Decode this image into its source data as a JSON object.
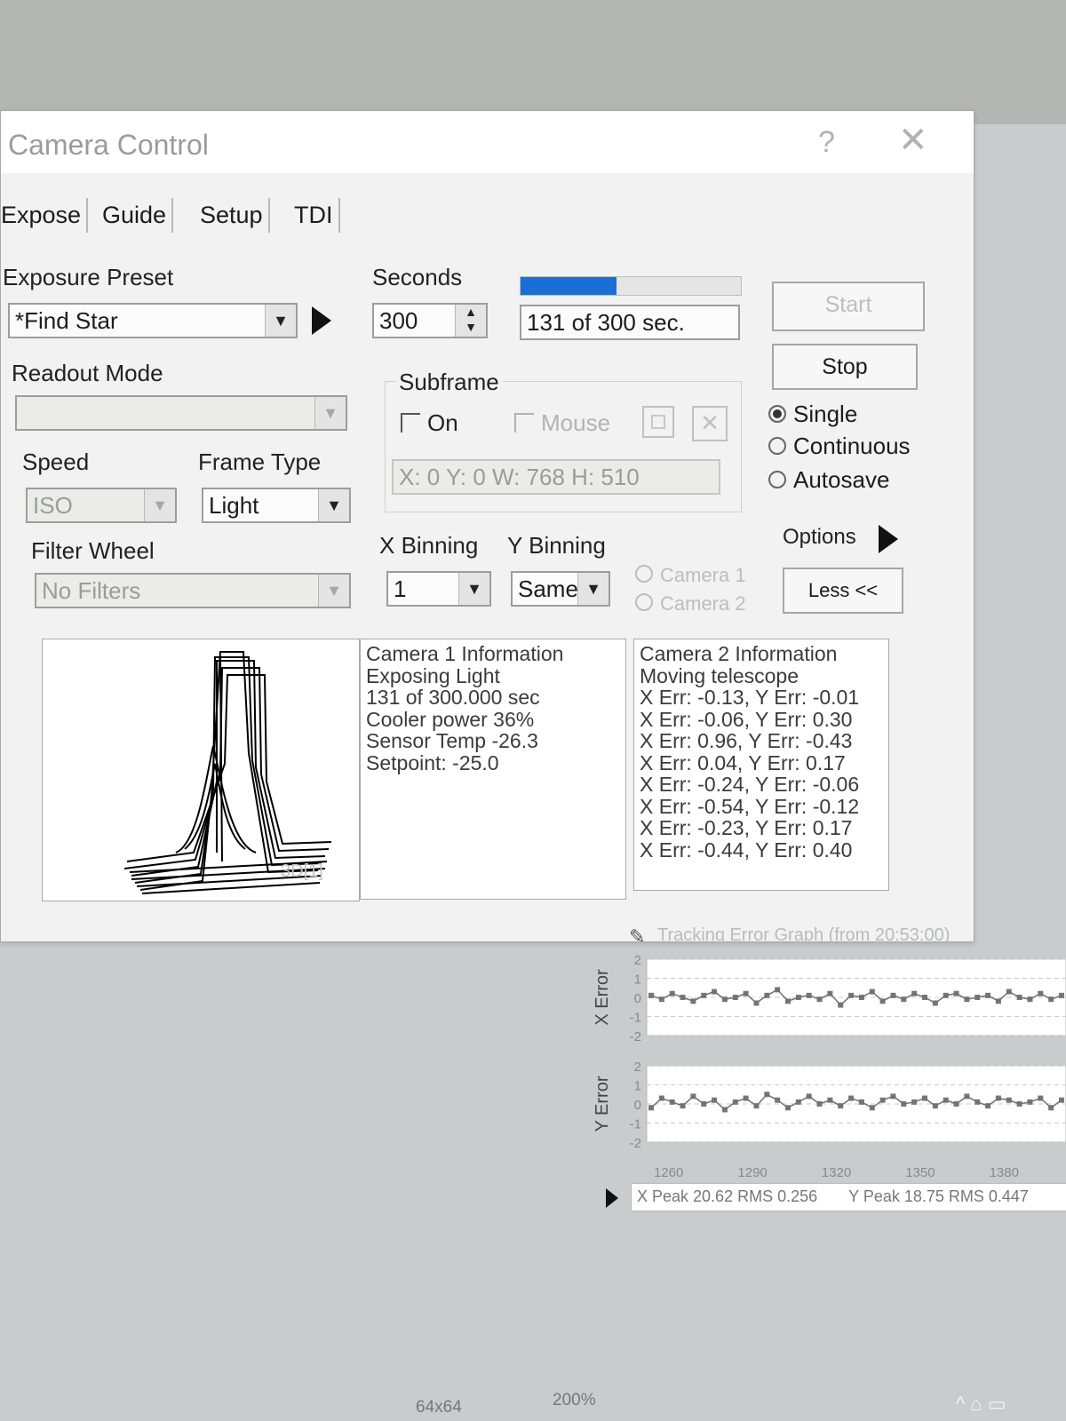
{
  "window": {
    "title": "Camera Control",
    "help": "?",
    "close": "✕"
  },
  "tabs": [
    "Expose",
    "Guide",
    "Setup",
    "TDI"
  ],
  "exposure": {
    "preset_label": "Exposure Preset",
    "preset_value": "*Find Star",
    "seconds_label": "Seconds",
    "seconds_value": "300",
    "progress_fraction": 0.437,
    "progress_text": "131 of 300 sec."
  },
  "buttons": {
    "start": "Start",
    "stop": "Stop",
    "options": "Options",
    "less": "Less <<"
  },
  "mode": {
    "single": "Single",
    "continuous": "Continuous",
    "autosave": "Autosave",
    "selected": "single"
  },
  "readout": {
    "label": "Readout Mode",
    "value": ""
  },
  "subframe": {
    "label": "Subframe",
    "on_label": "On",
    "mouse_label": "Mouse",
    "coords": "X: 0 Y: 0 W: 768 H: 510"
  },
  "speed": {
    "label": "Speed",
    "value": "ISO"
  },
  "frame_type": {
    "label": "Frame Type",
    "value": "Light"
  },
  "filter_wheel": {
    "label": "Filter Wheel",
    "value": "No Filters"
  },
  "binning": {
    "x_label": "X Binning",
    "x_value": "1",
    "y_label": "Y Binning",
    "y_value": "Same"
  },
  "cameras": {
    "camera1": "Camera 1",
    "camera2": "Camera 2"
  },
  "preview": {
    "label": "3D[1]"
  },
  "camera1_info": [
    "Camera 1 Information",
    "Exposing Light",
    "131 of 300.000 sec",
    "Cooler power 36%",
    "Sensor Temp -26.3",
    "Setpoint: -25.0"
  ],
  "camera2_info": [
    "Camera 2 Information",
    "Moving telescope",
    "X Err: -0.13, Y Err: -0.01",
    "X Err: -0.06, Y Err: 0.30",
    "X Err: 0.96, Y Err: -0.43",
    "X Err: 0.04, Y Err: 0.17",
    "X Err: -0.24, Y Err: -0.06",
    "X Err: -0.54, Y Err: -0.12",
    "X Err: -0.23, Y Err: 0.17",
    "X Err: -0.44, Y Err: 0.40"
  ],
  "chart_data": {
    "type": "line",
    "title": "Tracking Error Graph (from 20:53:00)",
    "x_ticks": [
      "1260",
      "1290",
      "1320",
      "1350",
      "1380"
    ],
    "y_ticks": [
      "2",
      "1",
      "0",
      "-1",
      "-2"
    ],
    "ylim": [
      -2,
      2
    ],
    "series": [
      {
        "name": "X Error",
        "color": "#6f6f6f",
        "values": [
          0.1,
          -0.1,
          0.2,
          0,
          -0.2,
          0.1,
          0.3,
          -0.1,
          0,
          0.2,
          -0.3,
          0.1,
          0.4,
          -0.2,
          0,
          0.1,
          -0.1,
          0.2,
          -0.4,
          0.1,
          0,
          0.3,
          -0.2,
          0.1,
          -0.1,
          0.2,
          0,
          -0.3,
          0.1,
          0.2,
          -0.1,
          0,
          0.1,
          -0.2,
          0.3,
          0,
          -0.1,
          0.2,
          -0.1,
          0.1
        ]
      },
      {
        "name": "Y Error",
        "color": "#6f6f6f",
        "values": [
          -0.2,
          0.3,
          0.1,
          -0.1,
          0.4,
          0,
          0.2,
          -0.3,
          0.1,
          0.3,
          -0.1,
          0.5,
          0.2,
          -0.2,
          0.1,
          0.4,
          0,
          0.2,
          -0.1,
          0.3,
          0.1,
          -0.2,
          0.2,
          0.4,
          0,
          0.1,
          0.3,
          -0.1,
          0.2,
          0,
          0.4,
          0.1,
          -0.1,
          0.3,
          0.2,
          0,
          0.1,
          0.3,
          -0.2,
          0.2
        ]
      }
    ],
    "stats": {
      "x": "X Peak 20.62 RMS 0.256",
      "y": "Y Peak 18.75 RMS 0.447"
    }
  },
  "taskbar": {
    "size": "64x64",
    "zoom": "200%"
  }
}
